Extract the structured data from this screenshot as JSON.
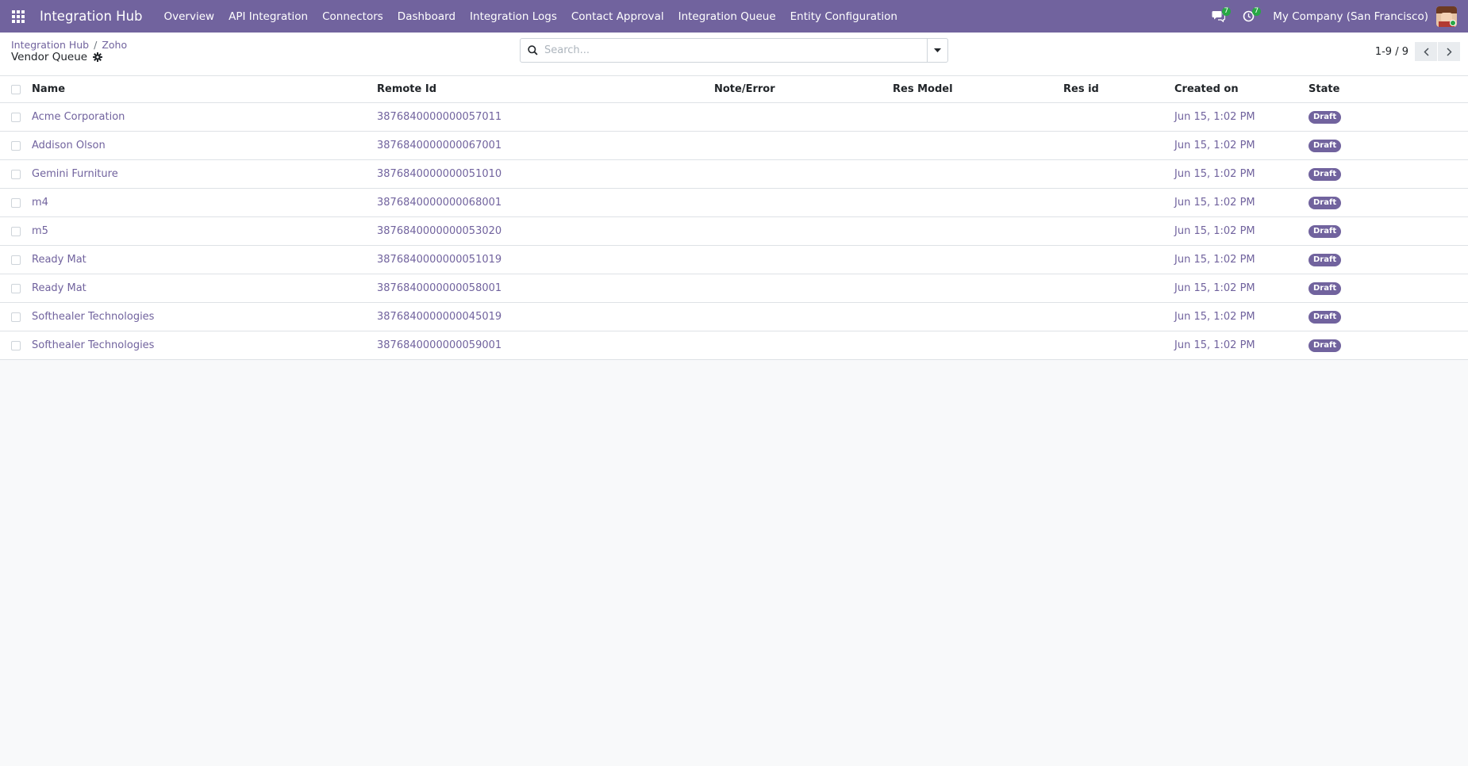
{
  "navbar": {
    "brand": "Integration Hub",
    "menu": [
      "Overview",
      "API Integration",
      "Connectors",
      "Dashboard",
      "Integration Logs",
      "Contact Approval",
      "Integration Queue",
      "Entity Configuration"
    ],
    "messages_count": "7",
    "activities_count": "7",
    "company": "My Company (San Francisco)"
  },
  "breadcrumb": {
    "root": "Integration Hub",
    "separator": "/",
    "current": "Zoho"
  },
  "page": {
    "title": "Vendor Queue"
  },
  "search": {
    "placeholder": "Search..."
  },
  "pager": {
    "value": "1-9 / 9"
  },
  "table": {
    "headers": {
      "name": "Name",
      "remote_id": "Remote Id",
      "note": "Note/Error",
      "res_model": "Res Model",
      "res_id": "Res id",
      "created": "Created on",
      "state": "State"
    },
    "rows": [
      {
        "name": "Acme Corporation",
        "remote_id": "3876840000000057011",
        "note": "",
        "res_model": "",
        "res_id": "",
        "created": "Jun 15, 1:02 PM",
        "state": "Draft"
      },
      {
        "name": "Addison Olson",
        "remote_id": "3876840000000067001",
        "note": "",
        "res_model": "",
        "res_id": "",
        "created": "Jun 15, 1:02 PM",
        "state": "Draft"
      },
      {
        "name": "Gemini Furniture",
        "remote_id": "3876840000000051010",
        "note": "",
        "res_model": "",
        "res_id": "",
        "created": "Jun 15, 1:02 PM",
        "state": "Draft"
      },
      {
        "name": "m4",
        "remote_id": "3876840000000068001",
        "note": "",
        "res_model": "",
        "res_id": "",
        "created": "Jun 15, 1:02 PM",
        "state": "Draft"
      },
      {
        "name": "m5",
        "remote_id": "3876840000000053020",
        "note": "",
        "res_model": "",
        "res_id": "",
        "created": "Jun 15, 1:02 PM",
        "state": "Draft"
      },
      {
        "name": "Ready Mat",
        "remote_id": "3876840000000051019",
        "note": "",
        "res_model": "",
        "res_id": "",
        "created": "Jun 15, 1:02 PM",
        "state": "Draft"
      },
      {
        "name": "Ready Mat",
        "remote_id": "3876840000000058001",
        "note": "",
        "res_model": "",
        "res_id": "",
        "created": "Jun 15, 1:02 PM",
        "state": "Draft"
      },
      {
        "name": "Softhealer Technologies",
        "remote_id": "3876840000000045019",
        "note": "",
        "res_model": "",
        "res_id": "",
        "created": "Jun 15, 1:02 PM",
        "state": "Draft"
      },
      {
        "name": "Softhealer Technologies",
        "remote_id": "3876840000000059001",
        "note": "",
        "res_model": "",
        "res_id": "",
        "created": "Jun 15, 1:02 PM",
        "state": "Draft"
      }
    ]
  },
  "colors": {
    "brand": "#71639e",
    "badge_green": "#28a745",
    "background": "#f8f9fa"
  },
  "icons": [
    "apps-grid-icon",
    "chat-bubbles-icon",
    "clock-icon",
    "gear-icon",
    "search-icon",
    "caret-down-icon",
    "chevron-left-icon",
    "chevron-right-icon"
  ]
}
